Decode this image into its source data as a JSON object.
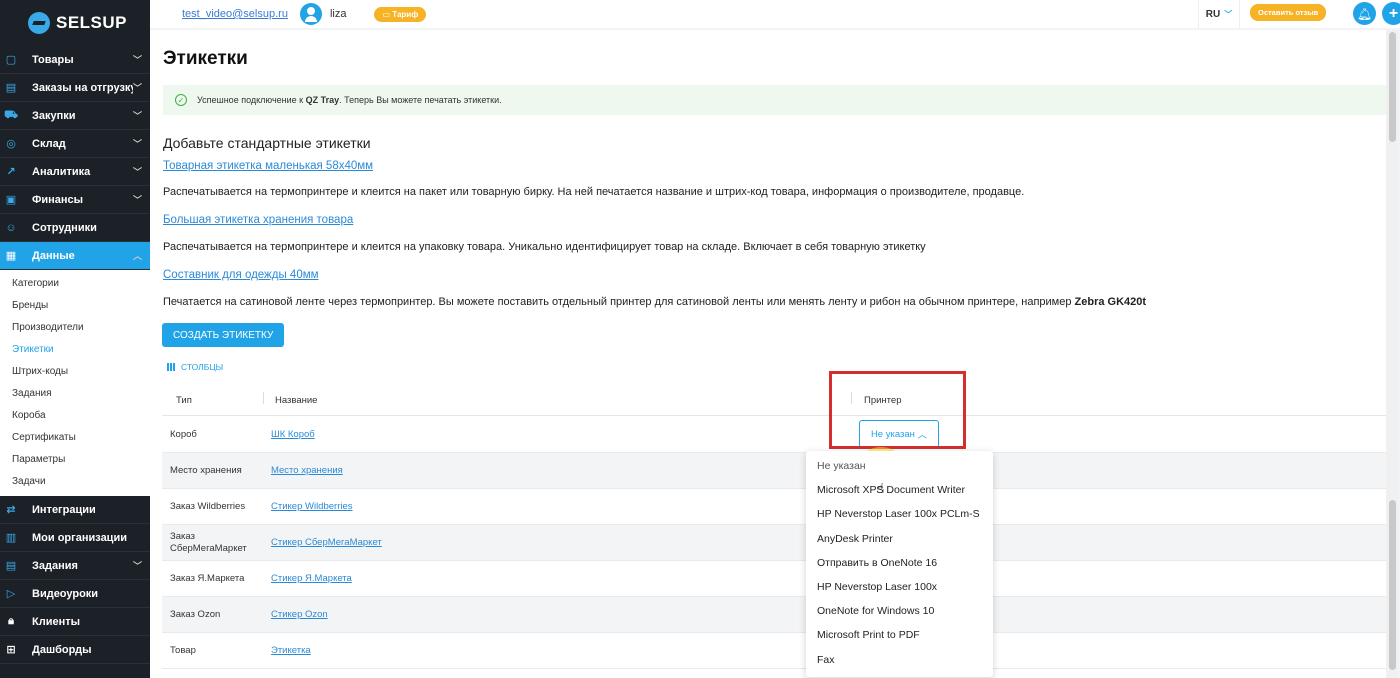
{
  "app": {
    "logo_text": "SELSUP"
  },
  "topbar": {
    "email": "test_video@selsup.ru",
    "user_name": "liza",
    "tariff_label": "Тариф",
    "lang": "RU",
    "feedback_label": "Оставить отзыв"
  },
  "sidebar": {
    "items_top": [
      {
        "label": "Товары",
        "icon": "box-icon"
      },
      {
        "label": "Заказы на отгрузку",
        "icon": "orders-icon"
      },
      {
        "label": "Закупки",
        "icon": "cart-icon"
      },
      {
        "label": "Склад",
        "icon": "warehouse-icon"
      },
      {
        "label": "Аналитика",
        "icon": "chart-icon"
      },
      {
        "label": "Финансы",
        "icon": "finance-icon"
      },
      {
        "label": "Сотрудники",
        "icon": "people-icon"
      },
      {
        "label": "Данные",
        "icon": "data-icon"
      }
    ],
    "sub_items": [
      "Категории",
      "Бренды",
      "Производители",
      "Этикетки",
      "Штрих-коды",
      "Задания",
      "Короба",
      "Сертификаты",
      "Параметры",
      "Задачи"
    ],
    "items_bottom": [
      {
        "label": "Интеграции",
        "icon": "integrations-icon"
      },
      {
        "label": "Мои организации",
        "icon": "org-icon"
      },
      {
        "label": "Задания",
        "icon": "tasks-icon"
      },
      {
        "label": "Видеоуроки",
        "icon": "video-icon"
      },
      {
        "label": "Клиенты",
        "icon": "lock-icon"
      },
      {
        "label": "Дашборды",
        "icon": "dashboard-icon"
      }
    ]
  },
  "page": {
    "title": "Этикетки",
    "alert": {
      "prefix": "Успешное подключение к ",
      "strong": "QZ Tray",
      "suffix": ". Теперь Вы можете печатать этикетки."
    },
    "section_title": "Добавьте стандартные этикетки",
    "link1": "Товарная этикетка маленькая 58х40мм",
    "desc1": "Распечатывается на термопринтере и клеится на пакет или товарную бирку. На ней печатается название и штрих-код товара, информация о производителе, продавце.",
    "link2": "Большая этикетка хранения товара",
    "desc2": "Распечатывается на термопринтере и клеится на упаковку товара. Уникально идентифицирует товар на складе. Включает в себя товарную этикетку",
    "link3": "Составник для одежды 40мм",
    "desc3_prefix": "Печатается на сатиновой ленте через термопринтер. Вы можете поставить отдельный принтер для сатиновой ленты или менять ленту и рибон на обычном принтере, например ",
    "desc3_strong": "Zebra GK420t",
    "create_button": "СОЗДАТЬ ЭТИКЕТКУ"
  },
  "table": {
    "columns_button": "СТОЛБЦЫ",
    "headers": {
      "type": "Тип",
      "name": "Название",
      "printer": "Принтер"
    },
    "rows": [
      {
        "type": "Короб",
        "name": "ШК Короб",
        "printer": "Не указан"
      },
      {
        "type": "Место хранения",
        "name": "Место хранения"
      },
      {
        "type": "Заказ Wildberries",
        "name": "Стикер Wildberries"
      },
      {
        "type": "Заказ СберМегаМаркет",
        "name": "Стикер СберМегаМаркет"
      },
      {
        "type": "Заказ Я.Маркета",
        "name": "Стикер Я.Маркета"
      },
      {
        "type": "Заказ Ozon",
        "name": "Стикер Ozon"
      },
      {
        "type": "Товар",
        "name": "Этикетка"
      }
    ]
  },
  "printer_dropdown": {
    "options": [
      "Не указан",
      "Microsoft XPS Document Writer",
      "HP Neverstop Laser 100x PCLm-S",
      "AnyDesk Printer",
      "Отправить в OneNote 16",
      "HP Neverstop Laser 100x",
      "OneNote for Windows 10",
      "Microsoft Print to PDF",
      "Fax"
    ]
  }
}
